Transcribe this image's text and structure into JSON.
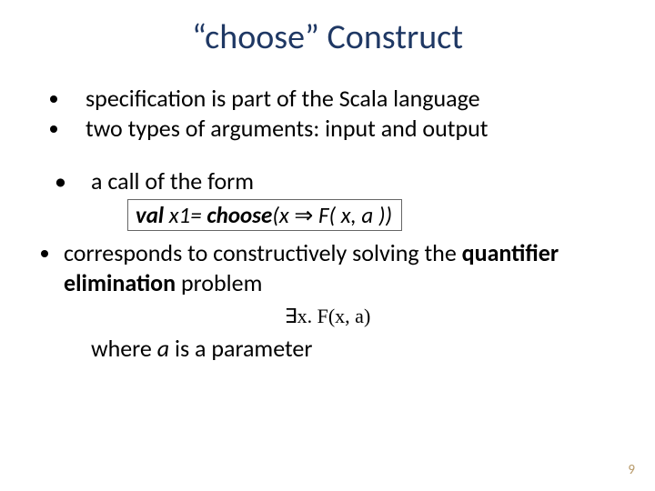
{
  "title": "“choose” Construct",
  "bullets_top": [
    "specification is part of the Scala language",
    "two types of arguments: input and output"
  ],
  "call_intro": "a call of the form",
  "code": {
    "kw1": "val",
    "part1": " x1= ",
    "kw2": "choose",
    "part2": "(x ",
    "arrow": "⇒",
    "part3": " F( x, a ))"
  },
  "corresponds": {
    "pre": "corresponds to constructively solving the ",
    "bold": "quantifier elimination",
    "post": " problem"
  },
  "formula": "∃x. F(x, a)",
  "param": {
    "pre": "where ",
    "var": "a",
    "post": " is a parameter"
  },
  "page_number": "9"
}
